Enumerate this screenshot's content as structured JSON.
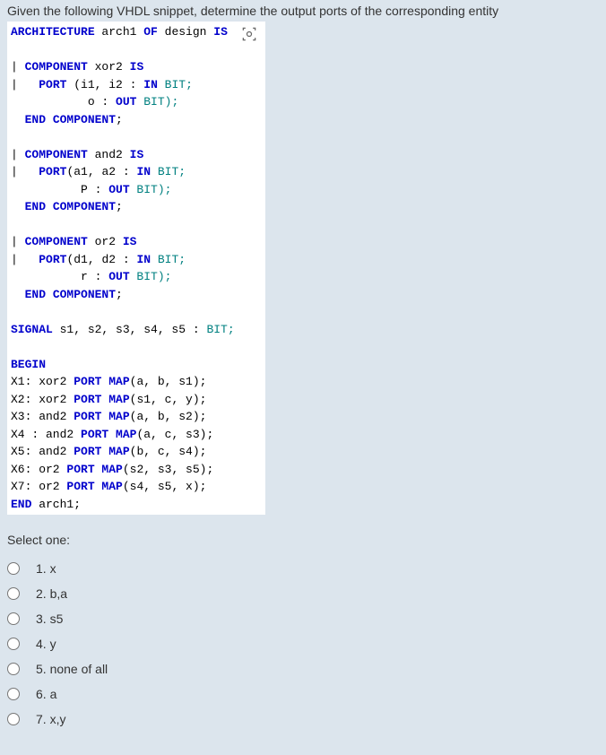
{
  "question": "Given the following VHDL snippet, determine the output ports of the corresponding entity",
  "code": {
    "line1_kw1": "ARCHITECTURE",
    "line1_txt": " arch1 ",
    "line1_kw2": "OF",
    "line1_txt2": " design ",
    "line1_kw3": "IS",
    "comp1_line1_kw": "COMPONENT",
    "comp1_line1_txt": " xor2 ",
    "comp1_line1_kw2": "IS",
    "comp1_line2_kw": "PORT",
    "comp1_line2_txt": " (i1, i2 : ",
    "comp1_line2_kw2": "IN",
    "comp1_line2_txt2": " BIT;",
    "comp1_line3_txt": "           o : ",
    "comp1_line3_kw": "OUT",
    "comp1_line3_txt2": " BIT);",
    "comp1_line4_kw": "END",
    "comp1_line4_txt": " ",
    "comp1_line4_kw2": "COMPONENT",
    "comp1_line4_txt2": ";",
    "comp2_line1_kw": "COMPONENT",
    "comp2_line1_txt": " and2 ",
    "comp2_line1_kw2": "IS",
    "comp2_line2_kw": "PORT",
    "comp2_line2_txt": "(a1, a2 : ",
    "comp2_line2_kw2": "IN",
    "comp2_line2_txt2": " BIT;",
    "comp2_line3_txt": "          P : ",
    "comp2_line3_kw": "OUT",
    "comp2_line3_txt2": " BIT);",
    "comp2_line4_kw": "END",
    "comp2_line4_txt": " ",
    "comp2_line4_kw2": "COMPONENT",
    "comp2_line4_txt2": ";",
    "comp3_line1_kw": "COMPONENT",
    "comp3_line1_txt": " or2 ",
    "comp3_line1_kw2": "IS",
    "comp3_line2_kw": "PORT",
    "comp3_line2_txt": "(d1, d2 : ",
    "comp3_line2_kw2": "IN",
    "comp3_line2_txt2": " BIT;",
    "comp3_line3_txt": "          r : ",
    "comp3_line3_kw": "OUT",
    "comp3_line3_txt2": " BIT);",
    "comp3_line4_kw": "END",
    "comp3_line4_txt": " ",
    "comp3_line4_kw2": "COMPONENT",
    "comp3_line4_txt2": ";",
    "signal_kw": "SIGNAL",
    "signal_txt": " s1, s2, s3, s4, s5 : ",
    "signal_txt2": "BIT;",
    "begin_kw": "BEGIN",
    "x1_txt": "X1: xor2 ",
    "x1_kw": "PORT MAP",
    "x1_txt2": "(a, b, s1);",
    "x2_txt": "X2: xor2 ",
    "x2_kw": "PORT MAP",
    "x2_txt2": "(s1, c, y);",
    "x3_txt": "X3: and2 ",
    "x3_kw": "PORT MAP",
    "x3_txt2": "(a, b, s2);",
    "x4_txt": "X4 : and2 ",
    "x4_kw": "PORT MAP",
    "x4_txt2": "(a, c, s3);",
    "x5_txt": "X5: and2 ",
    "x5_kw": "PORT MAP",
    "x5_txt2": "(b, c, s4);",
    "x6_txt": "X6: or2 ",
    "x6_kw": "PORT MAP",
    "x6_txt2": "(s2, s3, s5);",
    "x7_txt": "X7: or2 ",
    "x7_kw": "PORT MAP",
    "x7_txt2": "(s4, s5, x);",
    "end_kw": "END",
    "end_txt": " arch1;"
  },
  "select_prompt": "Select one:",
  "options": [
    "1. x",
    "2. b,a",
    "3. s5",
    "4. y",
    "5. none of all",
    "6. a",
    "7. x,y"
  ]
}
